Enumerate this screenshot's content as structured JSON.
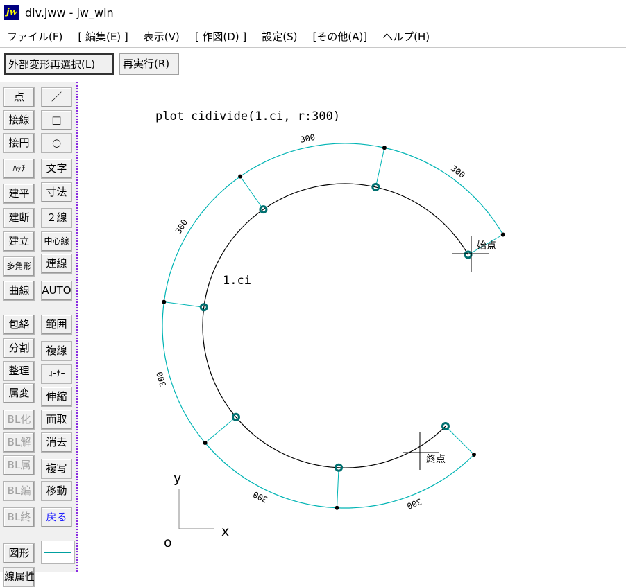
{
  "window": {
    "title": "div.jww - jw_win",
    "icon": "jw-app-icon"
  },
  "menu": [
    "ファイル(F)",
    "[ 編集(E) ]",
    "表示(V)",
    "[ 作図(D) ]",
    "設定(S)",
    "[その他(A)]",
    "ヘルプ(H)"
  ],
  "toolbar": {
    "reselect_label": "外部変形再選択(L)",
    "redo_label": "再実行(R)"
  },
  "left_tools": [
    "点",
    "／",
    "接線",
    "□",
    "接円",
    "○",
    "ﾊｯﾁ",
    "文字",
    "建平",
    "寸法",
    "建断",
    "２線",
    "建立",
    "中心線",
    "多角形",
    "連線",
    "曲線",
    "AUTO",
    "包絡",
    "範囲",
    "分割",
    "複線",
    "整理",
    "ｺｰﾅｰ",
    "属変",
    "伸縮",
    "BL化",
    "面取",
    "BL解",
    "消去",
    "BL属",
    "複写",
    "BL編",
    "移動",
    "BL終",
    "戻る",
    "図形",
    "線属性"
  ],
  "drawing": {
    "command_text": "plot cidivide(1.ci, r:300)",
    "circle_label": "1.ci",
    "start_label": "始点",
    "end_label": "終点",
    "segment_dims": [
      "300",
      "300",
      "300",
      "300",
      "300",
      "300"
    ],
    "axis_y": "y",
    "axis_x": "x",
    "origin": "o",
    "divisions": 6,
    "colors": {
      "arc": "#000000",
      "dim": "#00b4b4",
      "marker": "#007070"
    }
  }
}
